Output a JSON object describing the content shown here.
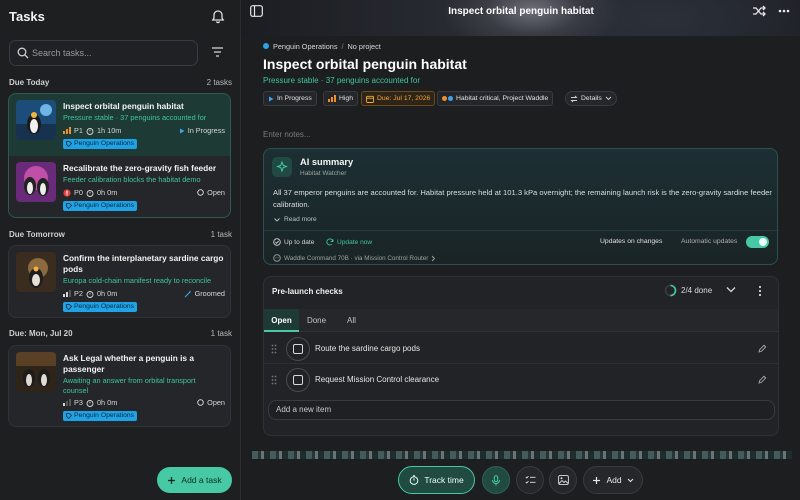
{
  "sidebar": {
    "title": "Tasks",
    "search_placeholder": "Search tasks...",
    "groups": [
      {
        "label": "Due Today",
        "count": "2 tasks"
      },
      {
        "label": "Due Tomorrow",
        "count": "1 task"
      },
      {
        "label": "Due: Mon, Jul 20",
        "count": "1 task"
      }
    ],
    "tasks": [
      {
        "title": "Inspect orbital penguin habitat",
        "subtitle": "Pressure stable · 37 penguins accounted for",
        "priority": "P1",
        "duration": "1h 10m",
        "status": "In Progress",
        "tag": "Penguin Operations"
      },
      {
        "title": "Recalibrate the zero-gravity fish feeder",
        "subtitle": "Feeder calibration blocks the habitat demo",
        "priority": "P0",
        "duration": "0h 0m",
        "status": "Open",
        "tag": "Penguin Operations"
      },
      {
        "title_l1": "Confirm the interplanetary sardine cargo",
        "title_l2": "pods",
        "subtitle": "Europa cold-chain manifest ready to reconcile",
        "priority": "P2",
        "duration": "0h 0m",
        "status": "Groomed",
        "tag": "Penguin Operations"
      },
      {
        "title_l1": "Ask Legal whether a penguin is a",
        "title_l2": "passenger",
        "subtitle_l1": "Awaiting an answer from orbital transport",
        "subtitle_l2": "counsel",
        "priority": "P3",
        "duration": "0h 0m",
        "status": "Open",
        "tag": "Penguin Operations"
      }
    ],
    "add_task_label": "Add a task"
  },
  "detail": {
    "banner_title": "Inspect orbital penguin habitat",
    "breadcrumb": {
      "project_group": "Penguin Operations",
      "separator": "/",
      "project": "No project"
    },
    "title": "Inspect orbital penguin habitat",
    "subtitle": "Pressure stable · 37 penguins accounted for",
    "chips": {
      "status": "In Progress",
      "priority": "High",
      "due": "Due: Jul 17, 2026",
      "labels": "Habitat critical, Project Waddle",
      "details": "Details"
    },
    "notes_placeholder": "Enter notes...",
    "ai": {
      "title": "AI summary",
      "subtitle": "Habitat Watcher",
      "body": "All 37 emperor penguins are accounted for. Habitat pressure held at 101.3 kPa overnight; the remaining launch risk is the zero-gravity sardine feeder calibration.",
      "read_more": "Read more",
      "up_to_date": "Up to date",
      "update_now": "Update now",
      "updates_on_changes": "Updates on changes",
      "automatic_updates": "Automatic updates",
      "automatic_on": true,
      "model": "Waddle Command 70B · via Mission Control Router"
    },
    "checklist": {
      "title": "Pre-launch checks",
      "progress_text": "2/4 done",
      "progress_fraction": 0.5,
      "tabs": [
        "Open",
        "Done",
        "All"
      ],
      "active_tab": "Open",
      "items": [
        "Route the sardine cargo pods",
        "Request Mission Control clearance"
      ],
      "add_placeholder": "Add a new item"
    },
    "bottom_bar": {
      "track_time": "Track time",
      "add": "Add"
    }
  },
  "colors": {
    "accent": "#46c9a4",
    "success_text": "#3ec79a",
    "tag_blue": "#1fa3e6",
    "due_orange": "#f0a93a",
    "p0_red": "#e2453c",
    "p1_orange": "#f0902a"
  }
}
